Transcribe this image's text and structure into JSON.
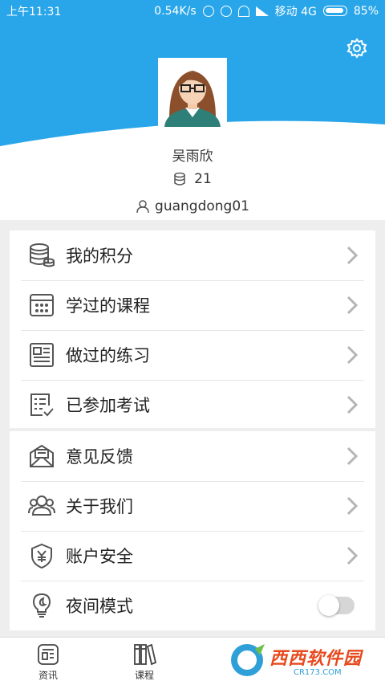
{
  "status_bar": {
    "time": "上午11:31",
    "speed": "0.54K/s",
    "carrier": "移动 4G",
    "battery": "85%"
  },
  "profile": {
    "name": "吴雨欣",
    "points": "21",
    "account": "guangdong01"
  },
  "colors": {
    "accent": "#29a6e9",
    "icon": "#555555",
    "chevron": "#b5b5b5"
  },
  "menu": {
    "items": [
      {
        "label": "我的积分",
        "icon": "coins-icon"
      },
      {
        "label": "学过的课程",
        "icon": "calendar-icon"
      },
      {
        "label": "做过的练习",
        "icon": "document-icon"
      },
      {
        "label": "已参加考试",
        "icon": "checklist-icon"
      }
    ],
    "items2": [
      {
        "label": "意见反馈",
        "icon": "envelope-icon"
      },
      {
        "label": "关于我们",
        "icon": "users-icon"
      },
      {
        "label": "账户安全",
        "icon": "shield-yen-icon"
      },
      {
        "label": "夜间模式",
        "icon": "bulb-icon"
      }
    ]
  },
  "tabbar": {
    "tabs": [
      {
        "label": "资讯",
        "icon": "news-icon"
      },
      {
        "label": "课程",
        "icon": "books-icon"
      }
    ]
  },
  "watermark": {
    "text": "西西软件园",
    "sub": "CR173.COM"
  }
}
